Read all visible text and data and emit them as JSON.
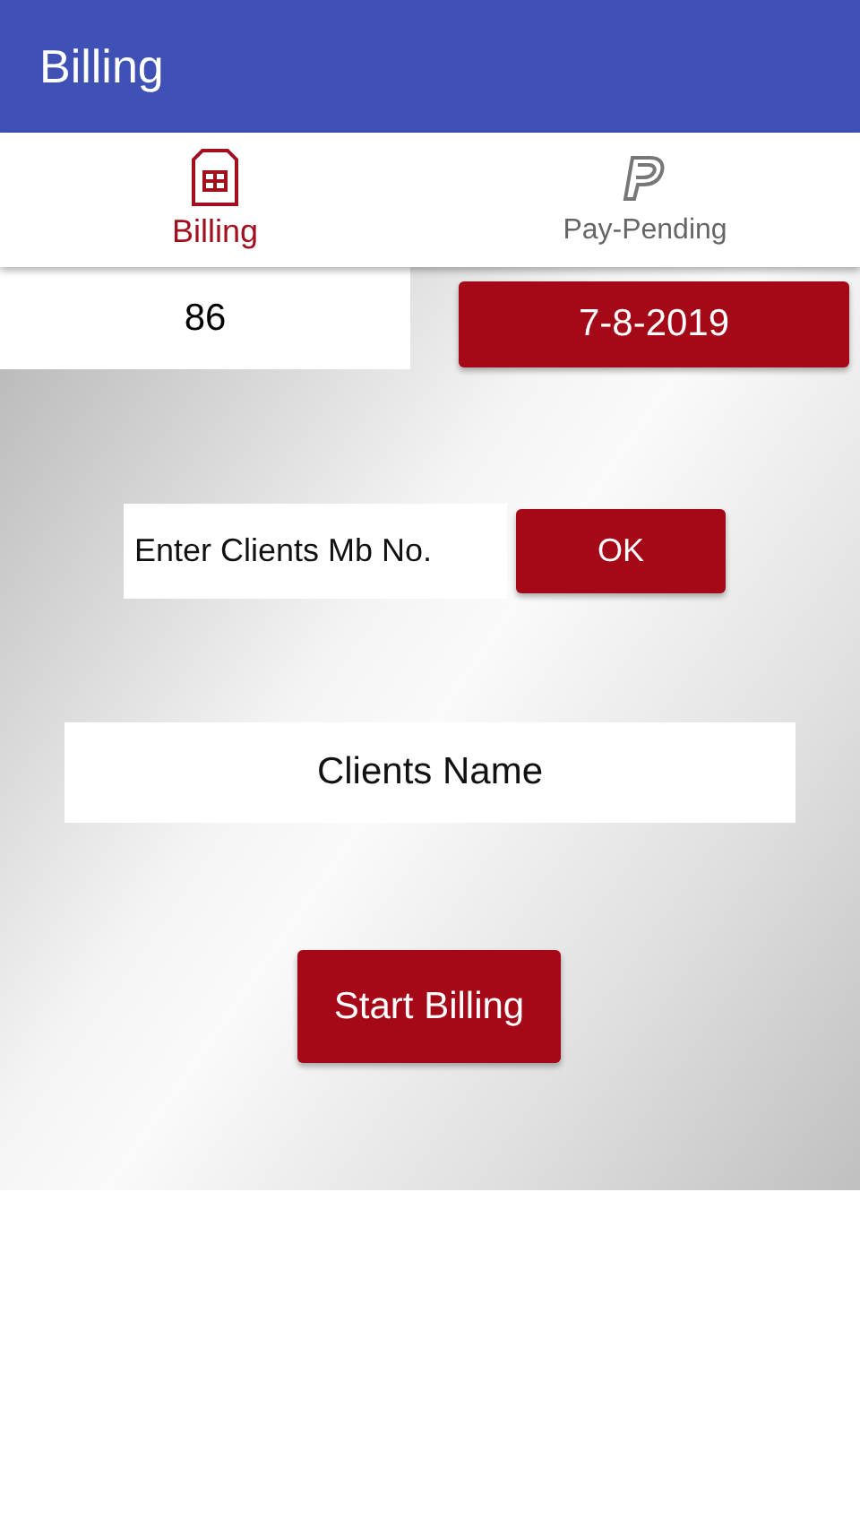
{
  "app_bar": {
    "title": "Billing"
  },
  "tabs": [
    {
      "label": "Billing",
      "kind": "sheet",
      "selected": true
    },
    {
      "label": "Pay-Pending",
      "kind": "paypal",
      "selected": false
    }
  ],
  "bill_number": "86",
  "date_button": "7-8-2019",
  "mobile_field": {
    "placeholder": "Enter Clients Mb No."
  },
  "ok_button": "OK",
  "client_name": "Clients Name",
  "start_button": "Start Billing"
}
